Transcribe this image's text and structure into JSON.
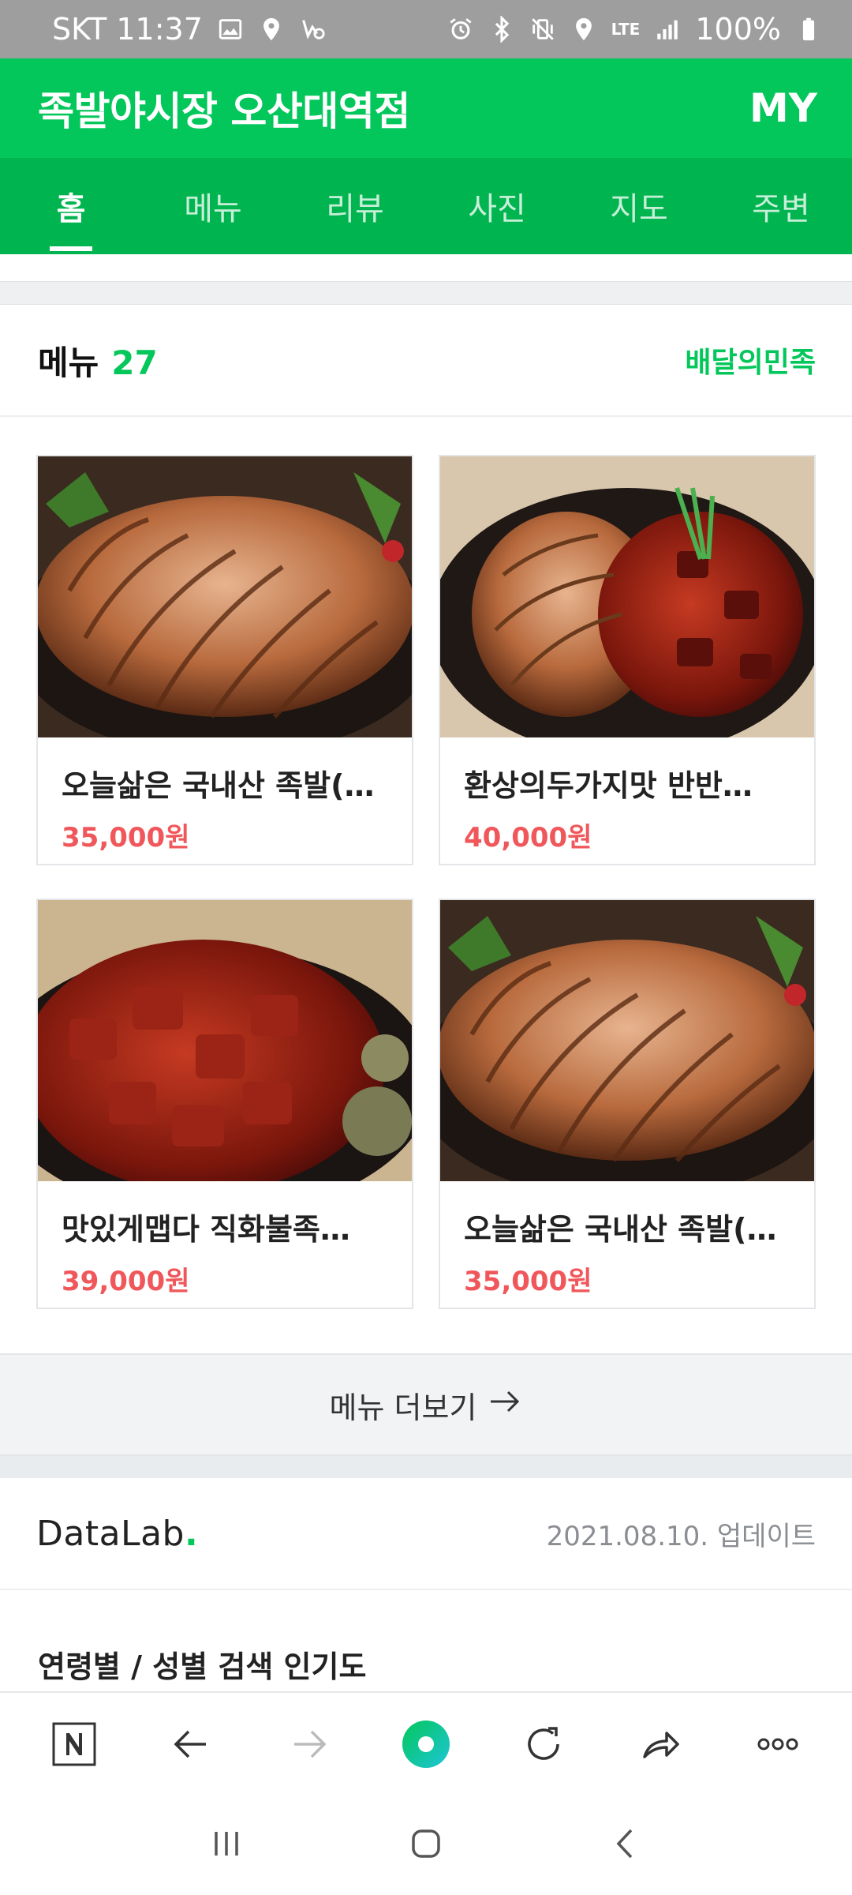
{
  "status_bar": {
    "carrier_time": "SKT 11:37",
    "network": "LTE",
    "battery": "100%",
    "left_icons": [
      "image-icon",
      "location-icon",
      "mute-call-icon"
    ],
    "right_icons": [
      "alarm-icon",
      "bluetooth-icon",
      "vibrate-icon",
      "location-icon",
      "signal-icon",
      "battery-icon"
    ]
  },
  "header": {
    "title": "족발야시장 오산대역점",
    "my_label": "MY"
  },
  "tabs": [
    {
      "label": "홈",
      "active": true
    },
    {
      "label": "메뉴",
      "active": false
    },
    {
      "label": "리뷰",
      "active": false
    },
    {
      "label": "사진",
      "active": false
    },
    {
      "label": "지도",
      "active": false
    },
    {
      "label": "주변",
      "active": false
    }
  ],
  "menu_section": {
    "label": "메뉴",
    "count": "27",
    "delivery_link": "배달의민족"
  },
  "menu_items": [
    {
      "name": "오늘삶은 국내산 족발(…",
      "price": "35,000원",
      "image": "sliced-jokbal-photo"
    },
    {
      "name": "환상의두가지맛 반반…",
      "price": "40,000원",
      "image": "half-half-jokbal-photo"
    },
    {
      "name": "맛있게맵다 직화불족…",
      "price": "39,000원",
      "image": "spicy-fire-jokbal-photo"
    },
    {
      "name": "오늘삶은 국내산 족발(…",
      "price": "35,000원",
      "image": "sliced-jokbal-photo"
    }
  ],
  "more_menu": {
    "label": "메뉴 더보기"
  },
  "datalab": {
    "logo_text": "DataLab",
    "logo_dot": ".",
    "updated": "2021.08.10. 업데이트"
  },
  "age_gender": {
    "title": "연령별 / 성별 검색 인기도"
  },
  "browser_bar": {
    "buttons": [
      "naver-home-icon",
      "back-arrow-icon",
      "forward-arrow-icon",
      "green-dot-icon",
      "refresh-icon",
      "share-icon",
      "more-icon"
    ]
  },
  "colors": {
    "brand_green": "#03c75a",
    "tab_green": "#00b550",
    "price_red": "#f0575b"
  }
}
